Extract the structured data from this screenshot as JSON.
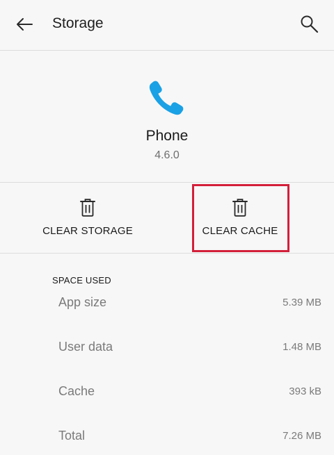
{
  "header": {
    "title": "Storage",
    "back_icon": "arrow-left-icon",
    "search_icon": "search-icon"
  },
  "app": {
    "icon": "phone-icon",
    "icon_color": "#1aa1e5",
    "name": "Phone",
    "version": "4.6.0"
  },
  "actions": {
    "clear_storage_label": "CLEAR STORAGE",
    "clear_cache_label": "CLEAR CACHE",
    "icon": "trash-icon",
    "highlight_color": "#d31f3a"
  },
  "space_used": {
    "header": "SPACE USED",
    "rows": [
      {
        "label": "App size",
        "value": "5.39 MB"
      },
      {
        "label": "User data",
        "value": "1.48 MB"
      },
      {
        "label": "Cache",
        "value": "393 kB"
      },
      {
        "label": "Total",
        "value": "7.26 MB"
      }
    ]
  }
}
